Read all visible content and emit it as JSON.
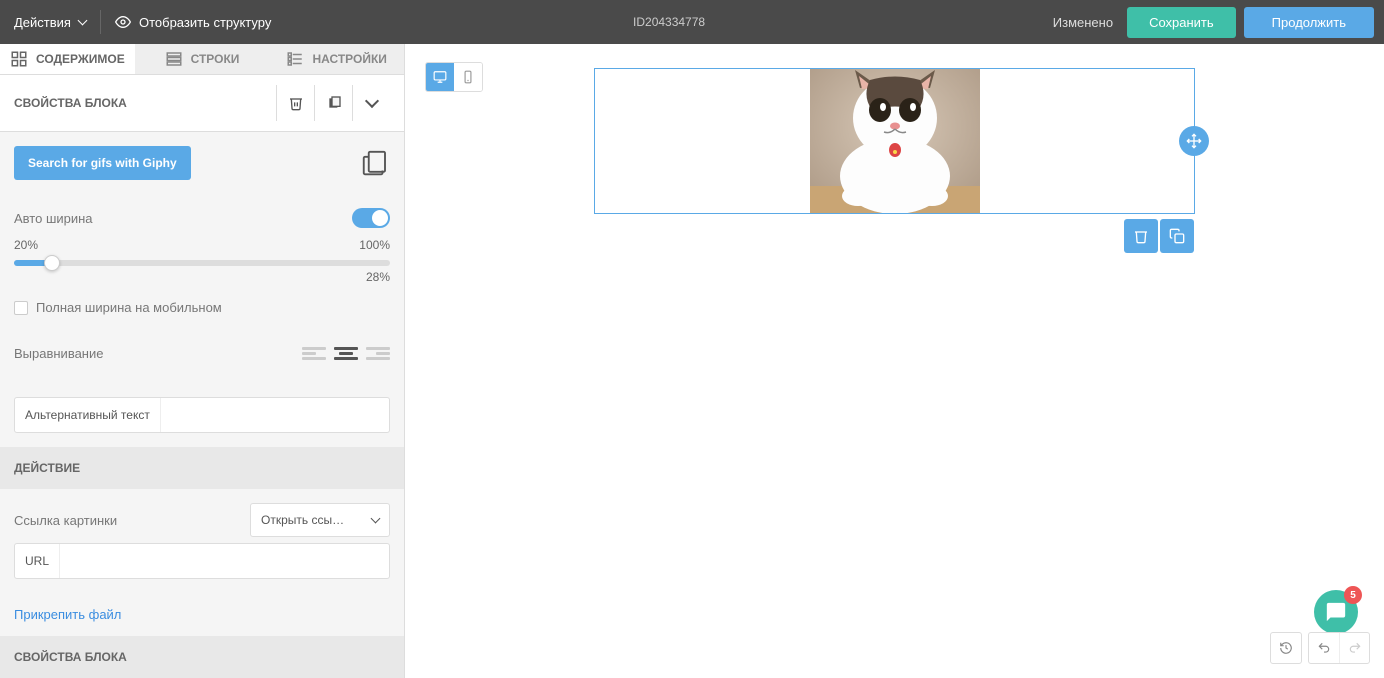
{
  "topbar": {
    "actions_label": "Действия",
    "show_structure": "Отобразить структуру",
    "doc_id": "ID204334778",
    "status": "Изменено",
    "save_label": "Сохранить",
    "continue_label": "Продолжить"
  },
  "tabs": {
    "content": "СОДЕРЖИМОЕ",
    "rows": "СТРОКИ",
    "settings": "НАСТРОЙКИ"
  },
  "panel": {
    "block_props_title": "СВОЙСТВА БЛОКА",
    "giphy_btn": "Search for gifs with Giphy",
    "auto_width_label": "Авто ширина",
    "scale_min": "20%",
    "scale_max": "100%",
    "width_current": "28%",
    "full_width_mobile": "Полная ширина на мобильном",
    "alignment_label": "Выравнивание",
    "alt_text_label": "Альтернативный текст",
    "action_title": "ДЕЙСТВИЕ",
    "image_link_label": "Ссылка картинки",
    "link_action_selected": "Открыть ссы…",
    "url_label": "URL",
    "attach_file": "Прикрепить файл",
    "block_props_2": "СВОЙСТВА БЛОКА"
  },
  "chat": {
    "badge": "5"
  }
}
